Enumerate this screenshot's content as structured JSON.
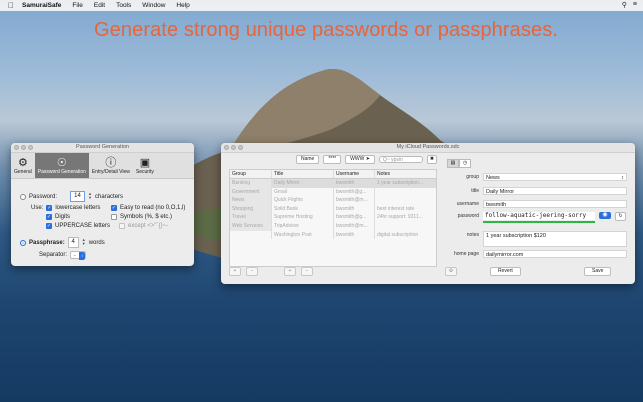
{
  "menubar": {
    "apple": "",
    "app_name": "SamuraiSafe",
    "items": [
      "File",
      "Edit",
      "Tools",
      "Window",
      "Help"
    ]
  },
  "headline": "Generate strong unique passwords or passphrases.",
  "pg_window": {
    "title": "Password Generation",
    "tabs": [
      {
        "label": "General",
        "icon": "gear-icon"
      },
      {
        "label": "Password Generation",
        "icon": "generator-icon"
      },
      {
        "label": "Entry/Detail View",
        "icon": "info-icon"
      },
      {
        "label": "Security",
        "icon": "security-icon"
      }
    ],
    "password_label": "Password:",
    "password_length": "14",
    "characters_label": "characters",
    "use_label": "Use:",
    "opt_lowercase": "lowercase letters",
    "opt_digits": "Digits",
    "opt_uppercase": "UPPERCASE letters",
    "opt_easy": "Easy to read (no 0,O,1,l)",
    "opt_symbols": "Symbols (%, $ etc.)",
    "opt_except": "except <>\"`{}~-",
    "passphrase_label": "Passphrase:",
    "passphrase_words": "4",
    "words_label": "words",
    "separator_label": "Separator:",
    "separator_value": "-"
  },
  "main_window": {
    "title": "My iCloud Passwords.sdc",
    "btn_name": "Name",
    "btn_stars": "****",
    "btn_www": "WWW",
    "search_placeholder": "Q~ ypsin",
    "columns": [
      "Group",
      "Title",
      "Username",
      "Notes"
    ],
    "groups": [
      "Banking",
      "Government",
      "News",
      "Shopping",
      "Travel",
      "Web Services"
    ],
    "rows": [
      {
        "title": "Daily Mirror",
        "username": "bwsmith",
        "notes": "1 year subscription..."
      },
      {
        "title": "Gmail",
        "username": "bwsmith@g...",
        "notes": ""
      },
      {
        "title": "Quick Flights",
        "username": "bwsmith@m...",
        "notes": ""
      },
      {
        "title": "Solid Bank",
        "username": "bwsmith",
        "notes": "best interest rate"
      },
      {
        "title": "Supreme Hosting",
        "username": "bwsmith@g...",
        "notes": "24hr support: 9311..."
      },
      {
        "title": "TripAdvisor",
        "username": "bwsmith@m...",
        "notes": ""
      },
      {
        "title": "Washington Post",
        "username": "bwsmith",
        "notes": "digital subscription"
      }
    ],
    "detail": {
      "group_label": "group",
      "group_value": "News",
      "title_label": "title",
      "title_value": "Daily Mirror",
      "username_label": "username",
      "username_value": "bwsmith",
      "password_label": "password",
      "password_value": "follow-aquatic-jeering-sorry",
      "notes_label": "notes",
      "notes_value": "1 year subscription $120",
      "homepage_label": "home page",
      "homepage_value": "dailymirror.com",
      "revert_label": "Revert",
      "save_label": "Save"
    },
    "accent": "#2a6edb",
    "strength_color": "#2cb742"
  }
}
